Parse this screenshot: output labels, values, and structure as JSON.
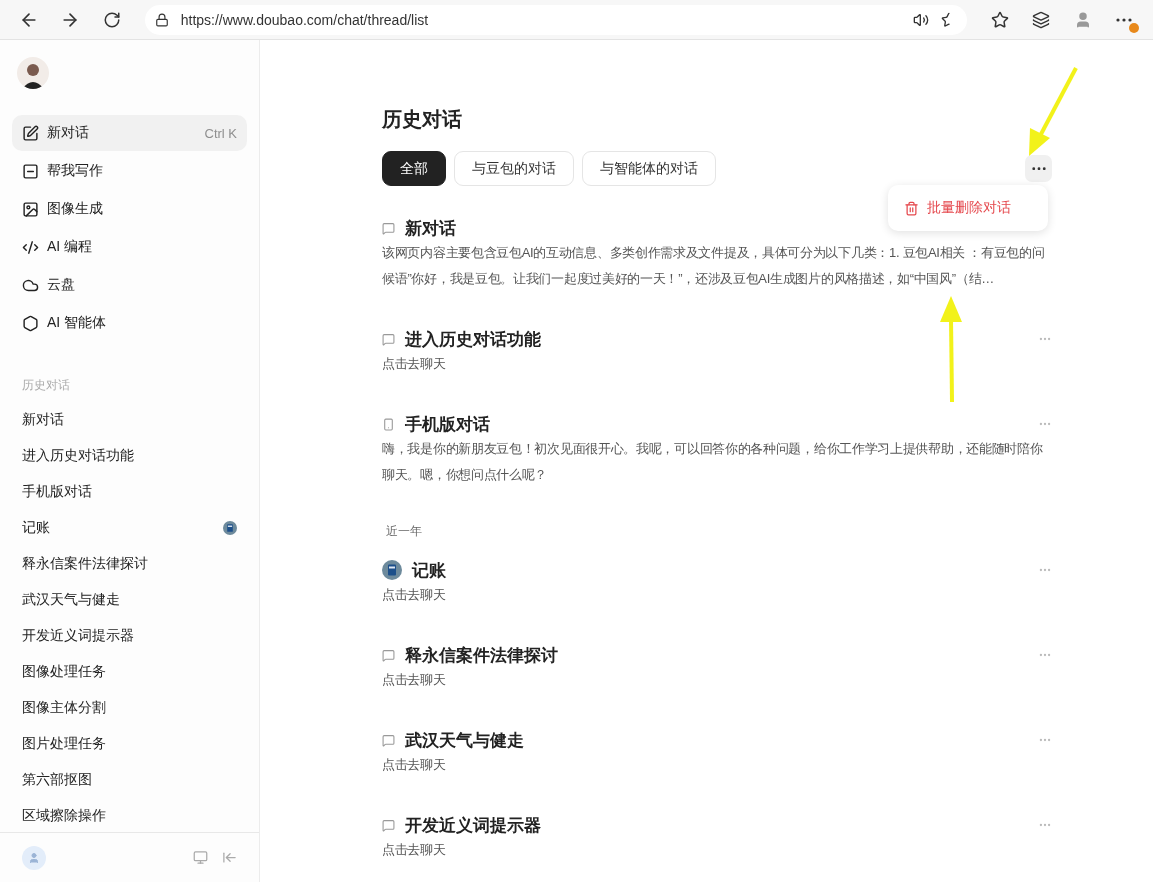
{
  "browser": {
    "url": "https://www.doubao.com/chat/thread/list",
    "has_update_badge": true
  },
  "sidebar": {
    "nav": [
      {
        "label": "新对话",
        "shortcut": "Ctrl K",
        "selected": true
      },
      {
        "label": "帮我写作",
        "selected": false
      },
      {
        "label": "图像生成",
        "selected": false
      },
      {
        "label": "AI 编程",
        "selected": false
      },
      {
        "label": "云盘",
        "selected": false
      },
      {
        "label": "AI 智能体",
        "selected": false
      }
    ],
    "history_heading": "历史对话",
    "history": [
      {
        "label": "新对话",
        "has_avatar": false
      },
      {
        "label": "进入历史对话功能",
        "has_avatar": false
      },
      {
        "label": "手机版对话",
        "has_avatar": false
      },
      {
        "label": "记账",
        "has_avatar": true
      },
      {
        "label": "释永信案件法律探讨",
        "has_avatar": false
      },
      {
        "label": "武汉天气与健走",
        "has_avatar": false
      },
      {
        "label": "开发近义词提示器",
        "has_avatar": false
      },
      {
        "label": "图像处理任务",
        "has_avatar": false
      },
      {
        "label": "图像主体分割",
        "has_avatar": false
      },
      {
        "label": "图片处理任务",
        "has_avatar": false
      },
      {
        "label": "第六部抠图",
        "has_avatar": false
      },
      {
        "label": "区域擦除操作",
        "has_avatar": false
      }
    ]
  },
  "main": {
    "title": "历史对话",
    "tabs": [
      {
        "label": "全部",
        "selected": true
      },
      {
        "label": "与豆包的对话",
        "selected": false
      },
      {
        "label": "与智能体的对话",
        "selected": false
      }
    ],
    "menu": {
      "open": true,
      "items": [
        {
          "label": "批量删除对话"
        }
      ]
    },
    "groups": [
      {
        "items": [
          {
            "kind": "chat",
            "title": "新对话",
            "summary": "该网页内容主要包含豆包AI的互动信息、多类创作需求及文件提及，具体可分为以下几类：1. 豆包AI相关 ：有豆包的问候语”你好，我是豆包。让我们一起度过美好的一天！”，还涉及豆包AI生成图片的风格描述，如“中国风”（结…",
            "more": false
          },
          {
            "kind": "chat",
            "title": "进入历史对话功能",
            "summary": "点击去聊天",
            "more": true
          },
          {
            "kind": "phone",
            "title": "手机版对话",
            "summary": "嗨，我是你的新朋友豆包！初次见面很开心。我呢，可以回答你的各种问题，给你工作学习上提供帮助，还能随时陪你聊天。嗯，你想问点什么呢？",
            "more": true
          }
        ]
      },
      {
        "heading": "近一年",
        "items": [
          {
            "kind": "bot",
            "title": "记账",
            "summary": "点击去聊天",
            "more": true
          },
          {
            "kind": "chat",
            "title": "释永信案件法律探讨",
            "summary": "点击去聊天",
            "more": true
          },
          {
            "kind": "chat",
            "title": "武汉天气与健走",
            "summary": "点击去聊天",
            "more": true
          },
          {
            "kind": "chat",
            "title": "开发近义词提示器",
            "summary": "点击去聊天",
            "more": true
          }
        ]
      }
    ]
  }
}
